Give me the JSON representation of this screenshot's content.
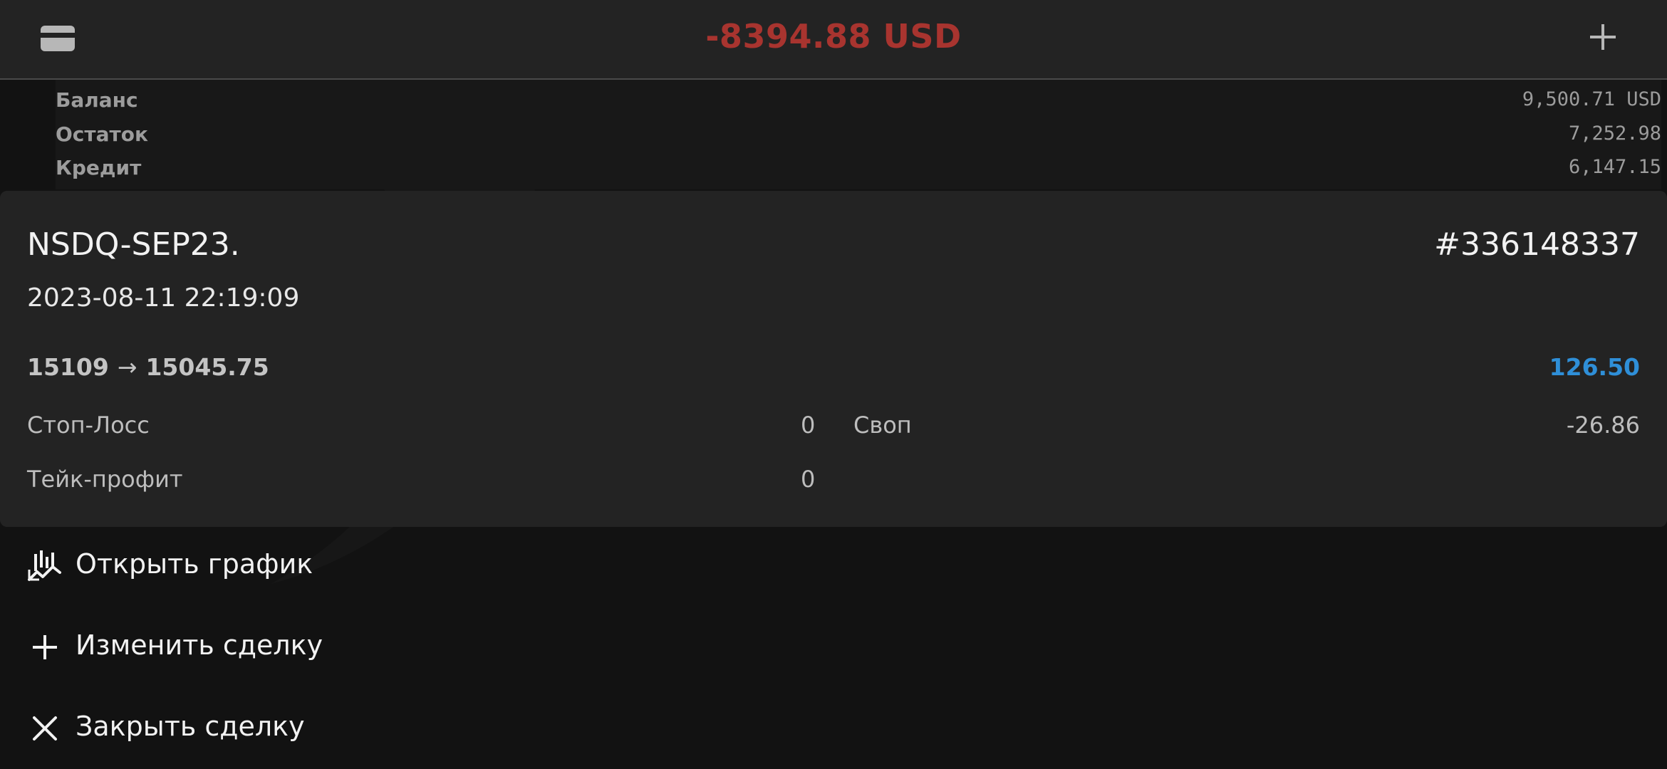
{
  "header": {
    "total": "-8394.88 USD",
    "icons": {
      "left": "wallet-icon",
      "right": "plus-icon"
    }
  },
  "account": {
    "rows": [
      {
        "label": "Баланс",
        "value": "9,500.71 USD"
      },
      {
        "label": "Остаток",
        "value": "7,252.98"
      },
      {
        "label": "Кредит",
        "value": "6,147.15"
      }
    ]
  },
  "trade": {
    "symbol": "NSDQ-SEP23.",
    "ticket": "#336148337",
    "open_time": "2023-08-11 22:19:09",
    "open_price": "15109",
    "arrow": "→",
    "current_price": "15045.75",
    "profit": "126.50",
    "stop_loss_label": "Стоп-Лосс",
    "stop_loss_value": "0",
    "take_profit_label": "Тейк-профит",
    "take_profit_value": "0",
    "swap_label": "Своп",
    "swap_value": "-26.86"
  },
  "actions": [
    {
      "label": "Открыть график",
      "icon": "chart-icon"
    },
    {
      "label": "Изменить сделку",
      "icon": "plus-icon"
    },
    {
      "label": "Закрыть сделку",
      "icon": "close-icon"
    }
  ],
  "colors": {
    "negative": "#a8342f",
    "profit": "#2f8fd8",
    "background": "#121212",
    "card": "#232323"
  }
}
